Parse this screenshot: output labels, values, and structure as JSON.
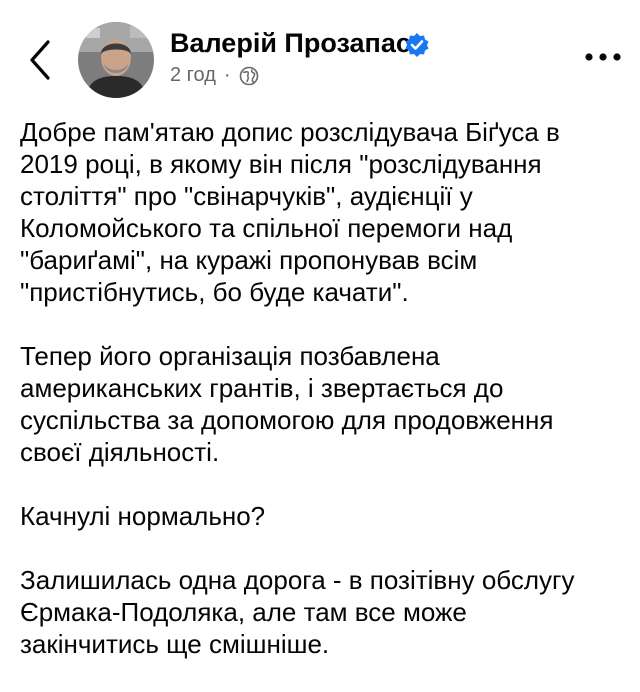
{
  "header": {
    "author_name": "Валерій Прозапас",
    "time": "2 год",
    "separator": "·",
    "icons": {
      "back": "chevron-left-icon",
      "verified": "verified-badge-icon",
      "audience": "globe-icon",
      "more": "more-horizontal-icon"
    },
    "colors": {
      "verified": "#1877f2",
      "meta_text": "#65676b"
    }
  },
  "post": {
    "paragraphs": [
      "Добре пам'ятаю допис розслідувача Біґуса в\n2019 році, в якому він після \"розслідування\nстоліття\" про \"свінарчуків\", аудієнції у\nКоломойського та спільної перемоги над\n\"бариґамі\", на куражі пропонував всім\n\"пристібнутись, бо буде качати\".",
      "Тепер його організація позбавлена\nамериканських грантів, і звертається до\nсуспільства за допомогою для продовження\nсвоєї діяльності.",
      "Качнулі нормально?",
      "Залишилась одна дорога - в позітівну обслугу\nЄрмака-Подоляка, але там все може\nзакінчитись ще смішніше."
    ]
  }
}
